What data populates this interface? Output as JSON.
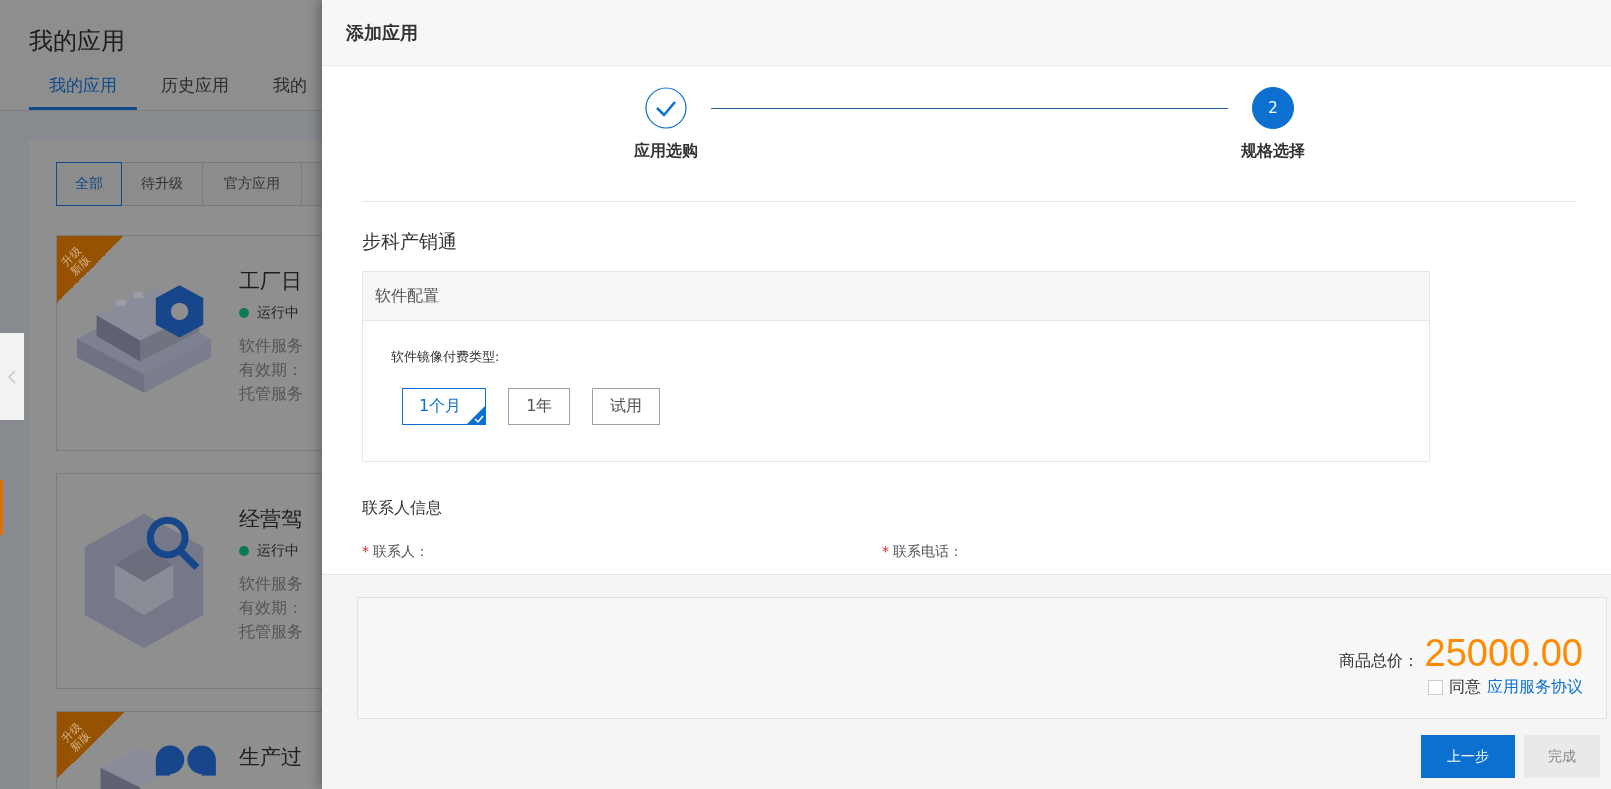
{
  "background_page": {
    "title": "我的应用",
    "tabs": [
      {
        "label": "我的应用",
        "selected": true
      },
      {
        "label": "历史应用",
        "selected": false
      },
      {
        "label": "我的",
        "selected": false
      }
    ],
    "filters": [
      {
        "label": "全部",
        "selected": true
      },
      {
        "label": "待升级",
        "selected": false
      },
      {
        "label": "官方应用",
        "selected": false
      }
    ],
    "cards": [
      {
        "kind": "calendar",
        "badge": [
          "升级",
          "新版"
        ],
        "title": "工厂日",
        "status": "运行中",
        "lines": [
          "软件服务",
          "有效期：",
          "托管服务"
        ]
      },
      {
        "kind": "search",
        "title": "经营驾",
        "status": "运行中",
        "lines": [
          "软件服务",
          "有效期：",
          "托管服务"
        ]
      },
      {
        "kind": "clover",
        "badge": [
          "升级",
          "新版"
        ],
        "title": "生产过"
      }
    ]
  },
  "drawer": {
    "title": "添加应用",
    "steps": [
      {
        "label": "应用选购",
        "done": true,
        "selected": false
      },
      {
        "label": "规格选择",
        "number": "2",
        "done": false,
        "selected": true
      }
    ],
    "product": "步科产销通",
    "config": {
      "title": "软件配置",
      "field_label": "软件镜像付费类型:",
      "options": [
        {
          "label": "1个月",
          "selected": true
        },
        {
          "label": "1年",
          "selected": false
        },
        {
          "label": "试用",
          "selected": false
        }
      ]
    },
    "contact": {
      "title": "联系人信息",
      "fields": [
        {
          "label": "联系人：",
          "required_mark": "*"
        },
        {
          "label": "联系电话：",
          "required_mark": "*"
        }
      ]
    },
    "summary": {
      "total_label": "商品总价：",
      "total": "25000.00",
      "agree_checked": false,
      "agree_label": "同意",
      "agreement_link": "应用服务协议"
    },
    "buttons": [
      {
        "label": "上一步",
        "kind": "primary",
        "disabled": false
      },
      {
        "label": "完成",
        "kind": "primary",
        "disabled": true
      }
    ]
  }
}
